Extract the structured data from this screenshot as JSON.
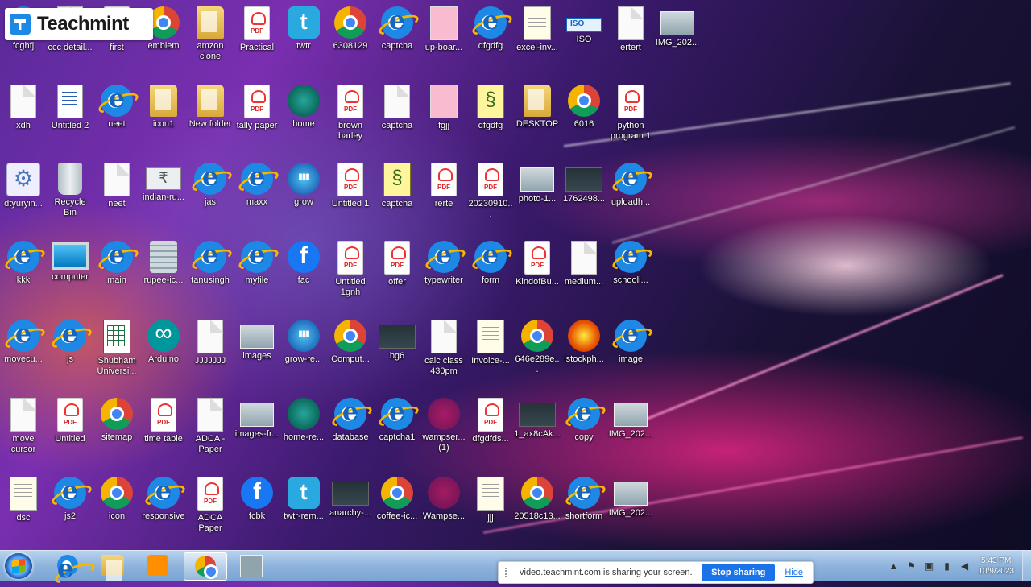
{
  "branding": {
    "logo_text": "Teachmint"
  },
  "desktop_icons": [
    {
      "label": "fcghfj",
      "type": "ie",
      "col": 0,
      "row": 0
    },
    {
      "label": "ccc detail...",
      "type": "blank",
      "col": 1,
      "row": 0
    },
    {
      "label": "first",
      "type": "pdf",
      "col": 2,
      "row": 0
    },
    {
      "label": "emblem",
      "type": "chrome",
      "col": 3,
      "row": 0
    },
    {
      "label": "amzon clone",
      "type": "folder",
      "col": 4,
      "row": 0
    },
    {
      "label": "Practical",
      "type": "pdf",
      "col": 5,
      "row": 0
    },
    {
      "label": "twtr",
      "type": "twitter",
      "col": 6,
      "row": 0
    },
    {
      "label": "6308129",
      "type": "chrome",
      "col": 7,
      "row": 0
    },
    {
      "label": "captcha",
      "type": "ie",
      "col": 8,
      "row": 0
    },
    {
      "label": "up-boar...",
      "type": "pinkfile",
      "col": 9,
      "row": 0
    },
    {
      "label": "dfgdfg",
      "type": "ie",
      "col": 10,
      "row": 0
    },
    {
      "label": "excel-inv...",
      "type": "note",
      "col": 11,
      "row": 0
    },
    {
      "label": "ISO",
      "type": "iso",
      "col": 12,
      "row": 0
    },
    {
      "label": "ertert",
      "type": "blank",
      "col": 13,
      "row": 0
    },
    {
      "label": "IMG_202...",
      "type": "img",
      "col": 14,
      "row": 0
    },
    {
      "label": "xdh",
      "type": "blank",
      "col": 0,
      "row": 1
    },
    {
      "label": "Untitled 2",
      "type": "doc",
      "col": 1,
      "row": 1
    },
    {
      "label": "neet",
      "type": "ie",
      "col": 2,
      "row": 1
    },
    {
      "label": "icon1",
      "type": "folder",
      "col": 3,
      "row": 1
    },
    {
      "label": "New folder",
      "type": "folder",
      "col": 4,
      "row": 1
    },
    {
      "label": "tally paper",
      "type": "pdf",
      "col": 5,
      "row": 1
    },
    {
      "label": "home",
      "type": "globe",
      "col": 6,
      "row": 1
    },
    {
      "label": "brown barley",
      "type": "pdf",
      "col": 7,
      "row": 1
    },
    {
      "label": "captcha",
      "type": "blank",
      "col": 8,
      "row": 1
    },
    {
      "label": "fgjj",
      "type": "pinkfile",
      "col": 9,
      "row": 1
    },
    {
      "label": "dfgdfg",
      "type": "script",
      "col": 10,
      "row": 1
    },
    {
      "label": "DESKTOP",
      "type": "folder",
      "col": 11,
      "row": 1
    },
    {
      "label": "6016",
      "type": "chrome",
      "col": 12,
      "row": 1
    },
    {
      "label": "python program 1",
      "type": "pdf",
      "col": 13,
      "row": 1
    },
    {
      "label": "dtyuryin...",
      "type": "gear",
      "col": 0,
      "row": 2
    },
    {
      "label": "Recycle Bin",
      "type": "bin",
      "col": 1,
      "row": 2
    },
    {
      "label": "neet",
      "type": "blank",
      "col": 2,
      "row": 2
    },
    {
      "label": "indian-ru...",
      "type": "money",
      "col": 3,
      "row": 2
    },
    {
      "label": "jas",
      "type": "ie",
      "col": 4,
      "row": 2
    },
    {
      "label": "maxx",
      "type": "ie",
      "col": 5,
      "row": 2
    },
    {
      "label": "grow",
      "type": "grow",
      "col": 6,
      "row": 2
    },
    {
      "label": "Untitled 1",
      "type": "pdf",
      "col": 7,
      "row": 2
    },
    {
      "label": "captcha",
      "type": "script",
      "col": 8,
      "row": 2
    },
    {
      "label": "rerte",
      "type": "pdf",
      "col": 9,
      "row": 2
    },
    {
      "label": "20230910...",
      "type": "pdf",
      "col": 10,
      "row": 2
    },
    {
      "label": "photo-1...",
      "type": "img",
      "col": 11,
      "row": 2
    },
    {
      "label": "1762498...",
      "type": "dark",
      "col": 12,
      "row": 2
    },
    {
      "label": "uploadh...",
      "type": "ie",
      "col": 13,
      "row": 2
    },
    {
      "label": "kkk",
      "type": "ie",
      "col": 0,
      "row": 3
    },
    {
      "label": "computer",
      "type": "pc",
      "col": 1,
      "row": 3
    },
    {
      "label": "main",
      "type": "ie",
      "col": 2,
      "row": 3
    },
    {
      "label": "rupee-ic...",
      "type": "coins",
      "col": 3,
      "row": 3
    },
    {
      "label": "tanusingh",
      "type": "ie",
      "col": 4,
      "row": 3
    },
    {
      "label": "myfile",
      "type": "ie",
      "col": 5,
      "row": 3
    },
    {
      "label": "fac",
      "type": "fb",
      "col": 6,
      "row": 3
    },
    {
      "label": "Untitled 1gnh",
      "type": "pdf",
      "col": 7,
      "row": 3
    },
    {
      "label": "offer",
      "type": "pdf",
      "col": 8,
      "row": 3
    },
    {
      "label": "typewriter",
      "type": "ie",
      "col": 9,
      "row": 3
    },
    {
      "label": "form",
      "type": "ie",
      "col": 10,
      "row": 3
    },
    {
      "label": "KindofBu...",
      "type": "pdf",
      "col": 11,
      "row": 3
    },
    {
      "label": "medium...",
      "type": "blank",
      "col": 12,
      "row": 3
    },
    {
      "label": "schooli...",
      "type": "ie",
      "col": 13,
      "row": 3
    },
    {
      "label": "movecu...",
      "type": "ie",
      "col": 0,
      "row": 4
    },
    {
      "label": "js",
      "type": "ie",
      "col": 1,
      "row": 4
    },
    {
      "label": "Shubham Universi...",
      "type": "excel",
      "col": 2,
      "row": 4
    },
    {
      "label": "Arduino",
      "type": "arduino",
      "col": 3,
      "row": 4
    },
    {
      "label": "JJJJJJJ",
      "type": "blank",
      "col": 4,
      "row": 4
    },
    {
      "label": "images",
      "type": "img",
      "col": 5,
      "row": 4
    },
    {
      "label": "grow-re...",
      "type": "grow",
      "col": 6,
      "row": 4
    },
    {
      "label": "Comput...",
      "type": "chrome",
      "col": 7,
      "row": 4
    },
    {
      "label": "bg6",
      "type": "dark",
      "col": 8,
      "row": 4
    },
    {
      "label": "calc class 430pm",
      "type": "blank",
      "col": 9,
      "row": 4
    },
    {
      "label": "Invoice-...",
      "type": "note",
      "col": 10,
      "row": 4
    },
    {
      "label": "646e289e...",
      "type": "chrome",
      "col": 11,
      "row": 4
    },
    {
      "label": "istockph...",
      "type": "orange",
      "col": 12,
      "row": 4
    },
    {
      "label": "image",
      "type": "ie",
      "col": 13,
      "row": 4
    },
    {
      "label": "move cursor",
      "type": "blank",
      "col": 0,
      "row": 5
    },
    {
      "label": "Untitled",
      "type": "pdf",
      "col": 1,
      "row": 5
    },
    {
      "label": "sitemap",
      "type": "chrome",
      "col": 2,
      "row": 5
    },
    {
      "label": "time table",
      "type": "pdf",
      "col": 3,
      "row": 5
    },
    {
      "label": "ADCA - Paper",
      "type": "blank",
      "col": 4,
      "row": 5
    },
    {
      "label": "images-fr...",
      "type": "img",
      "col": 5,
      "row": 5
    },
    {
      "label": "home-re...",
      "type": "globe",
      "col": 6,
      "row": 5
    },
    {
      "label": "database",
      "type": "ie",
      "col": 7,
      "row": 5
    },
    {
      "label": "captcha1",
      "type": "ie",
      "col": 8,
      "row": 5
    },
    {
      "label": "wampser... (1)",
      "type": "wamp",
      "col": 9,
      "row": 5
    },
    {
      "label": "dfgdfds...",
      "type": "pdf",
      "col": 10,
      "row": 5
    },
    {
      "label": "1_ax8cAk...",
      "type": "dark",
      "col": 11,
      "row": 5
    },
    {
      "label": "copy",
      "type": "ie",
      "col": 12,
      "row": 5
    },
    {
      "label": "IMG_202...",
      "type": "img",
      "col": 13,
      "row": 5
    },
    {
      "label": "dsc",
      "type": "note",
      "col": 0,
      "row": 6
    },
    {
      "label": "js2",
      "type": "ie",
      "col": 1,
      "row": 6
    },
    {
      "label": "icon",
      "type": "chrome",
      "col": 2,
      "row": 6
    },
    {
      "label": "responsive",
      "type": "ie",
      "col": 3,
      "row": 6
    },
    {
      "label": "ADCA Paper",
      "type": "pdf",
      "col": 4,
      "row": 6
    },
    {
      "label": "fcbk",
      "type": "fb",
      "col": 5,
      "row": 6
    },
    {
      "label": "twtr-rem...",
      "type": "twitter",
      "col": 6,
      "row": 6
    },
    {
      "label": "anarchy-...",
      "type": "dark",
      "col": 7,
      "row": 6
    },
    {
      "label": "coffee-ic...",
      "type": "chrome",
      "col": 8,
      "row": 6
    },
    {
      "label": "Wampse...",
      "type": "wamp",
      "col": 9,
      "row": 6
    },
    {
      "label": "jjj",
      "type": "note",
      "col": 10,
      "row": 6
    },
    {
      "label": "20518c13...",
      "type": "chrome",
      "col": 11,
      "row": 6
    },
    {
      "label": "shortform",
      "type": "ie",
      "col": 12,
      "row": 6
    },
    {
      "label": "IMG_202...",
      "type": "img",
      "col": 13,
      "row": 6
    }
  ],
  "taskbar": {
    "apps": [
      {
        "name": "internet-explorer",
        "active": false
      },
      {
        "name": "file-explorer",
        "active": false
      },
      {
        "name": "media-player",
        "active": false
      },
      {
        "name": "chrome",
        "active": true
      },
      {
        "name": "app-window",
        "active": false
      }
    ],
    "share_notice": {
      "message": "video.teachmint.com is sharing your screen.",
      "stop_label": "Stop sharing",
      "hide_label": "Hide"
    },
    "clock": {
      "time": "5:43 PM",
      "date": "10/9/2023"
    }
  }
}
